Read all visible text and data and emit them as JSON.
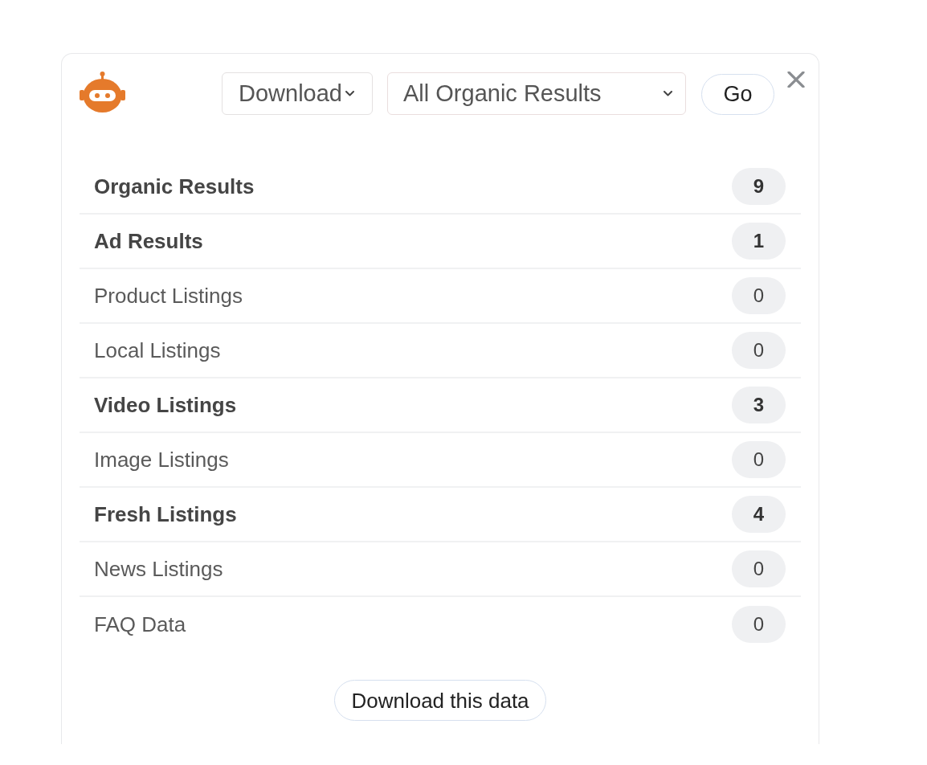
{
  "header": {
    "format_select": {
      "value": "Download"
    },
    "scope_select": {
      "value": "All Organic Results"
    },
    "go_button": {
      "label": "Go"
    }
  },
  "results": [
    {
      "label": "Organic Results",
      "count": "9",
      "bold": true
    },
    {
      "label": "Ad Results",
      "count": "1",
      "bold": true
    },
    {
      "label": "Product Listings",
      "count": "0",
      "bold": false
    },
    {
      "label": "Local Listings",
      "count": "0",
      "bold": false
    },
    {
      "label": "Video Listings",
      "count": "3",
      "bold": true
    },
    {
      "label": "Image Listings",
      "count": "0",
      "bold": false
    },
    {
      "label": "Fresh Listings",
      "count": "4",
      "bold": true
    },
    {
      "label": "News Listings",
      "count": "0",
      "bold": false
    },
    {
      "label": "FAQ Data",
      "count": "0",
      "bold": false
    }
  ],
  "download_button": {
    "label": "Download this data"
  }
}
